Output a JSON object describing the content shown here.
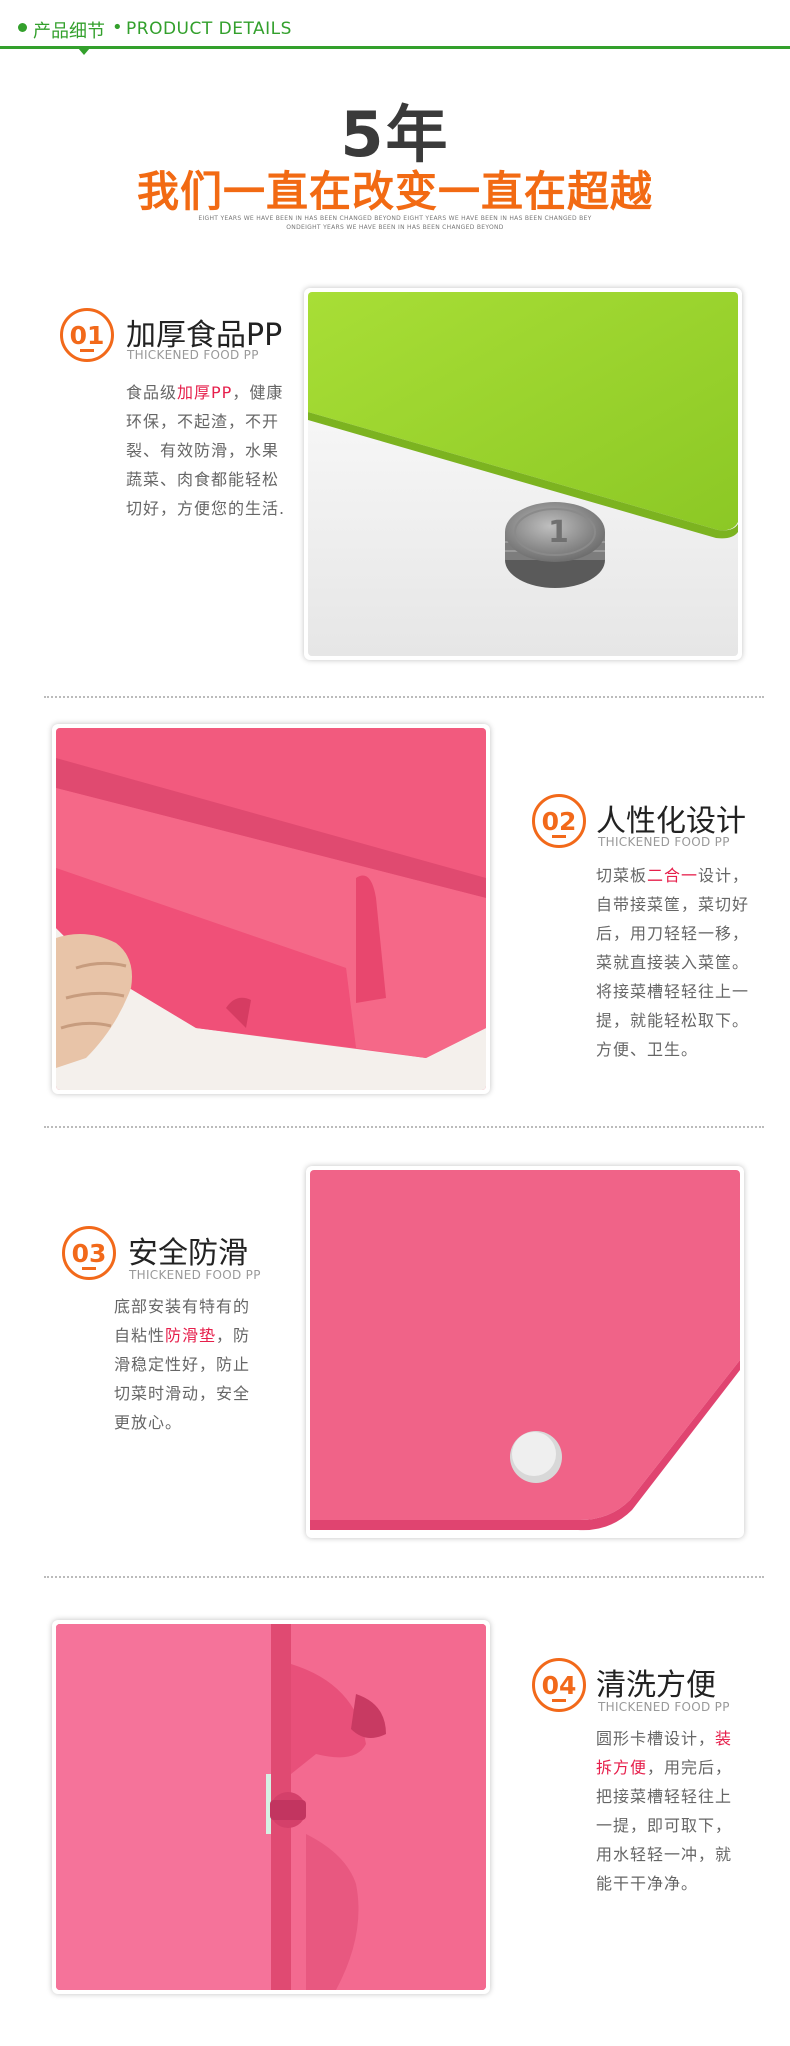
{
  "header": {
    "zh_title": "产品细节",
    "separator": "•",
    "en_title": "PRODUCT DETAILS"
  },
  "hero": {
    "years": "5年",
    "slogan": "我们一直在改变一直在超越",
    "en_line1": "EIGHT YEARS WE HAVE BEEN IN HAS BEEN CHANGED BEYOND EIGHT YEARS WE HAVE BEEN IN HAS BEEN CHANGED BEY",
    "en_line2": "ONDEIGHT YEARS WE HAVE BEEN IN HAS BEEN CHANGED BEYOND"
  },
  "features": [
    {
      "number": "01",
      "title": "加厚食品PP",
      "subtitle": "THICKENED FOOD PP",
      "lines": [
        {
          "pre": "食品级",
          "hl": "加厚PP",
          "post": "，健康"
        },
        {
          "pre": "环保，不起渣，不开",
          "hl": "",
          "post": ""
        },
        {
          "pre": "裂、有效防滑，水果",
          "hl": "",
          "post": ""
        },
        {
          "pre": "蔬菜、肉食都能轻松",
          "hl": "",
          "post": ""
        },
        {
          "pre": "切好，方便您的生活.",
          "hl": "",
          "post": ""
        }
      ]
    },
    {
      "number": "02",
      "title": "人性化设计",
      "subtitle": "THICKENED FOOD PP",
      "lines": [
        {
          "pre": "切菜板",
          "hl": "二合一",
          "post": "设计，"
        },
        {
          "pre": "自带接菜筐，菜切好",
          "hl": "",
          "post": ""
        },
        {
          "pre": "后，用刀轻轻一移，",
          "hl": "",
          "post": ""
        },
        {
          "pre": "菜就直接装入菜筐。",
          "hl": "",
          "post": ""
        },
        {
          "pre": "将接菜槽轻轻往上一",
          "hl": "",
          "post": ""
        },
        {
          "pre": "提，就能轻松取下。",
          "hl": "",
          "post": ""
        },
        {
          "pre": "方便、卫生。",
          "hl": "",
          "post": ""
        }
      ]
    },
    {
      "number": "03",
      "title": "安全防滑",
      "subtitle": "THICKENED FOOD PP",
      "lines": [
        {
          "pre": "底部安装有特有的",
          "hl": "",
          "post": ""
        },
        {
          "pre": "自粘性",
          "hl": "防滑垫",
          "post": "，防"
        },
        {
          "pre": "滑稳定性好，防止",
          "hl": "",
          "post": ""
        },
        {
          "pre": "切菜时滑动，安全",
          "hl": "",
          "post": ""
        },
        {
          "pre": "更放心。",
          "hl": "",
          "post": ""
        }
      ]
    },
    {
      "number": "04",
      "title": "清洗方便",
      "subtitle": "THICKENED FOOD PP",
      "lines": [
        {
          "pre": "圆形卡槽设计，",
          "hl": "装",
          "post": ""
        },
        {
          "pre": "",
          "hl": "拆方便",
          "post": "，用完后，"
        },
        {
          "pre": "把接菜槽轻轻往上",
          "hl": "",
          "post": ""
        },
        {
          "pre": "一提，即可取下，",
          "hl": "",
          "post": ""
        },
        {
          "pre": "用水轻轻一冲，就",
          "hl": "",
          "post": ""
        },
        {
          "pre": "能干干净净。",
          "hl": "",
          "post": ""
        }
      ]
    }
  ],
  "colors": {
    "brand_green": "#33a02c",
    "accent_orange": "#f2691a",
    "highlight_red": "#e61f4b",
    "board_green": "#9ad22c",
    "board_pink": "#f0557a"
  },
  "coin_text": "1"
}
